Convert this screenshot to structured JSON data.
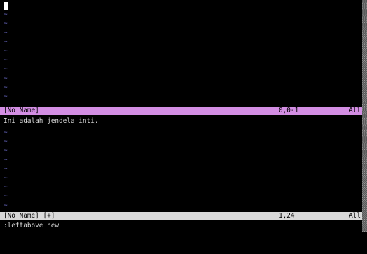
{
  "top_window": {
    "filler_glyph": "~",
    "status": {
      "name": "[No Name]",
      "position": "0,0-1",
      "scroll": "All",
      "color": "#d38ee3"
    }
  },
  "bottom_window": {
    "text_line": "Ini adalah jendela inti.",
    "filler_glyph": "~",
    "status": {
      "name": "[No Name] [+]",
      "position": "1,24",
      "scroll": "All",
      "color": "#d9d9d9"
    }
  },
  "command_line": ":leftabove new",
  "colors": {
    "background": "#000000",
    "tilde": "#4d4d8f",
    "text": "#d8d8d8"
  }
}
